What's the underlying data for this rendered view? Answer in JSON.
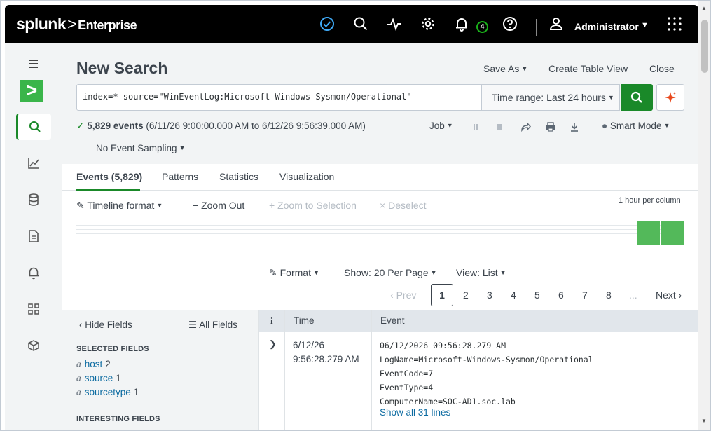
{
  "topbar": {
    "logo_brand": "splunk",
    "logo_sep": ">",
    "logo_product": "Enterprise",
    "notification_count": "4",
    "user_name": "Administrator",
    "icons": [
      "status-ok-icon",
      "search-icon",
      "activity-icon",
      "gear-icon",
      "bell-icon",
      "help-icon",
      "user-icon",
      "app-grid-icon"
    ]
  },
  "rail": {
    "menu_icon": "hamburger-icon",
    "brand_glyph": ">",
    "items": [
      "search-icon",
      "chart-icon",
      "database-icon",
      "document-icon",
      "bell-icon",
      "dashboard-icon",
      "package-icon"
    ]
  },
  "header": {
    "title": "New Search",
    "save_as": "Save As",
    "create_table_view": "Create Table View",
    "close": "Close"
  },
  "search": {
    "query": "index=* source=\"WinEventLog:Microsoft-Windows-Sysmon/Operational\"",
    "time_range": "Time range: Last 24 hours"
  },
  "status": {
    "event_count": "5,829 events",
    "range": "(6/11/26 9:00:00.000 AM to 6/12/26 9:56:39.000 AM)",
    "job": "Job",
    "smart_mode": "Smart Mode",
    "sampling": "No Event Sampling"
  },
  "tabs": [
    {
      "label": "Events (5,829)"
    },
    {
      "label": "Patterns"
    },
    {
      "label": "Statistics"
    },
    {
      "label": "Visualization"
    }
  ],
  "timeline": {
    "format": "Timeline format",
    "zoom_out": "Zoom Out",
    "zoom_selection": "Zoom to Selection",
    "deselect": "Deselect",
    "per_column": "1 hour per column"
  },
  "options": {
    "format": "Format",
    "show": "Show: 20 Per Page",
    "view": "View: List"
  },
  "pager": {
    "prev": "Prev",
    "pages": [
      "1",
      "2",
      "3",
      "4",
      "5",
      "6",
      "7",
      "8"
    ],
    "ellipsis": "...",
    "next": "Next"
  },
  "fields": {
    "hide": "Hide Fields",
    "all": "All Fields",
    "selected_title": "SELECTED FIELDS",
    "selected": [
      {
        "type": "a",
        "name": "host",
        "count": "2"
      },
      {
        "type": "a",
        "name": "source",
        "count": "1"
      },
      {
        "type": "a",
        "name": "sourcetype",
        "count": "1"
      }
    ],
    "interesting_title": "INTERESTING FIELDS"
  },
  "events": {
    "columns": {
      "info": "i",
      "time": "Time",
      "event": "Event"
    },
    "rows": [
      {
        "time_date": "6/12/26",
        "time_clock": "9:56:28.279 AM",
        "lines": [
          "06/12/2026 09:56:28.279 AM",
          "LogName=Microsoft-Windows-Sysmon/Operational",
          "EventCode=7",
          "EventType=4",
          "ComputerName=SOC-AD1.soc.lab"
        ],
        "show_all": "Show all 31 lines"
      }
    ]
  }
}
